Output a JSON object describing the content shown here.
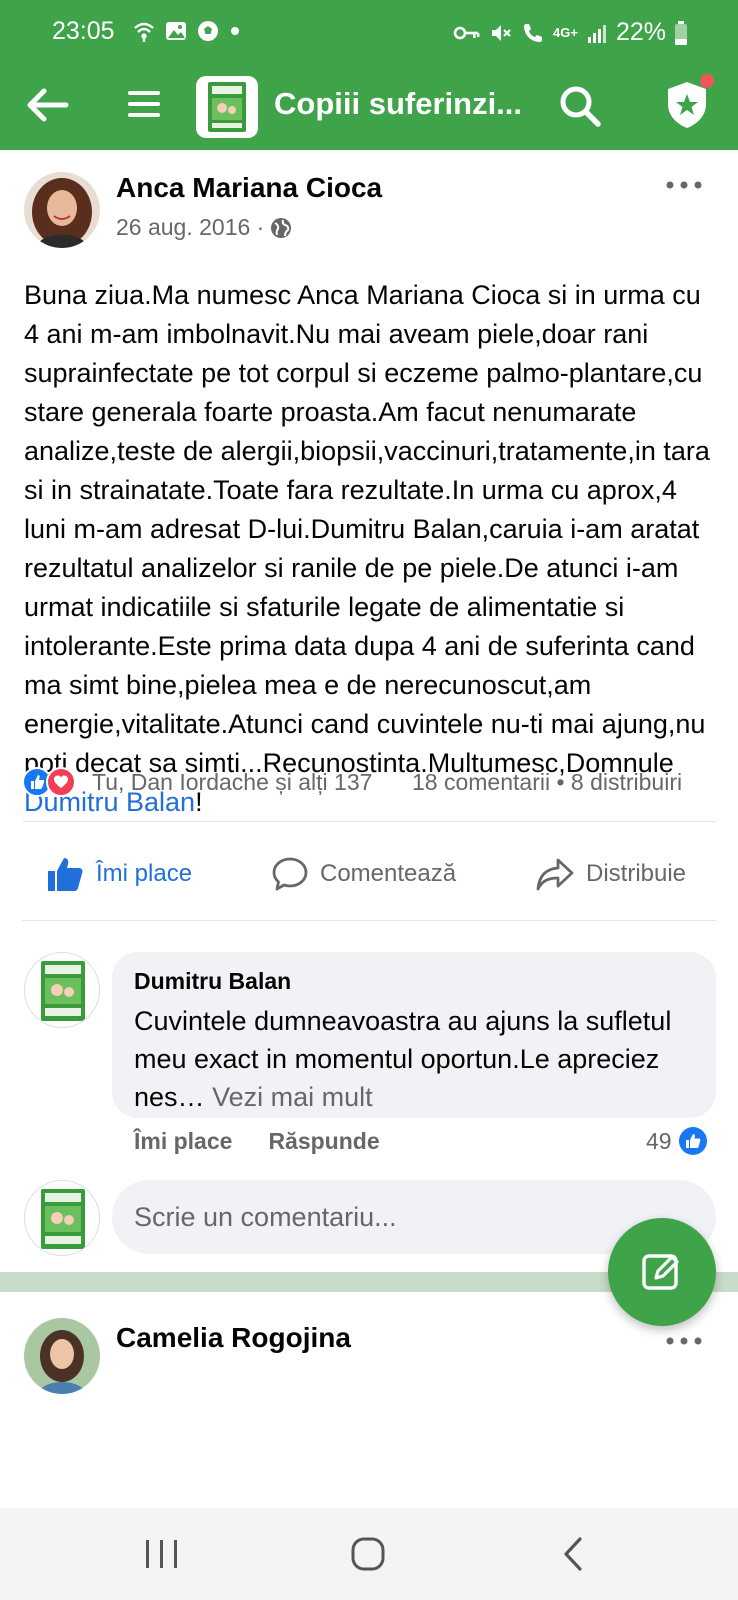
{
  "status_bar": {
    "time": "23:05",
    "network": "4G+",
    "battery": "22%"
  },
  "header": {
    "group_title": "Copiii suferinzi...",
    "accent_color": "#3fa34a"
  },
  "post": {
    "author": "Anca Mariana Cioca",
    "date": "26 aug. 2016 ·",
    "text": "Buna ziua.Ma numesc Anca Mariana Cioca si in urma cu 4 ani m-am imbolnavit.Nu mai aveam piele,doar rani suprainfectate pe tot corpul si eczeme palmo-plantare,cu stare generala foarte proasta.Am facut nenumarate analize,teste de alergii,biopsii,vaccinuri,tratamente,in tara si in strainatate.Toate fara rezultate.In urma cu aprox,4 luni m-am adresat D-lui.Dumitru Balan,caruia i-am aratat rezultatul analizelor si ranile de pe piele.De atunci i-am urmat indicatiile si sfaturile legate de alimentatie si intolerante.Este prima data dupa 4 ani de suferinta cand ma simt bine,pielea mea e de nerecunoscut,am energie,vitalitate.Atunci cand cuvintele nu-ti mai ajung,nu poti decat sa simti...Recunostinta.Multumesc,Domnule",
    "mention": "Dumitru Balan",
    "text_end": "!",
    "reactions_text": "Tu, Dan Iordache și alți 137",
    "counts_text": "18 comentarii • 8 distribuiri"
  },
  "actions": {
    "like": "Îmi place",
    "comment": "Comentează",
    "share": "Distribuie"
  },
  "comment": {
    "author": "Dumitru Balan",
    "text": "Cuvintele dumneavoastra au ajuns la sufletul meu exact in momentul oportun.Le apreciez nes…",
    "see_more": "Vezi mai mult",
    "like_label": "Îmi place",
    "reply_label": "Răspunde",
    "likes_count": "49"
  },
  "composer": {
    "placeholder": "Scrie un comentariu..."
  },
  "next_post": {
    "author": "Camelia Rogojina"
  }
}
